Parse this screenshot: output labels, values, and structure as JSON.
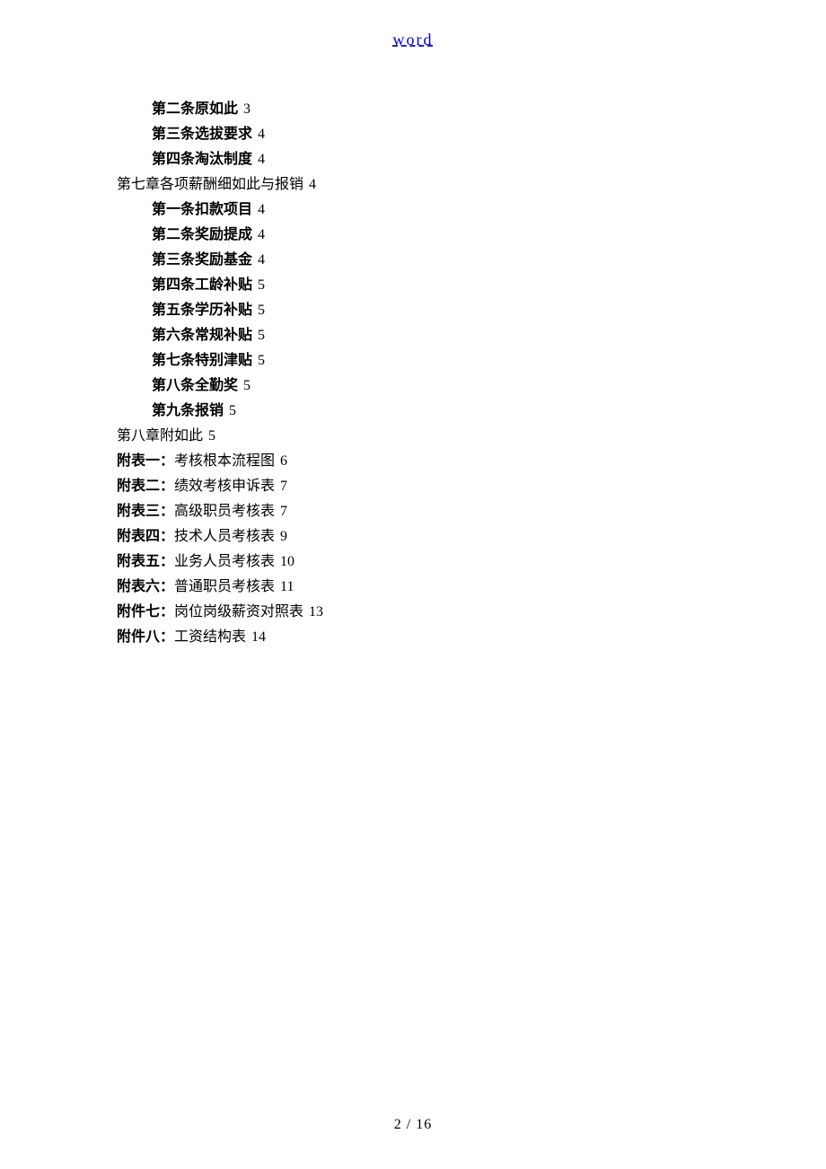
{
  "header": "word",
  "lines": [
    {
      "indent": true,
      "bold": true,
      "text": "第二条原如此",
      "page": "3"
    },
    {
      "indent": true,
      "bold": true,
      "text": "第三条选拔要求",
      "page": "4"
    },
    {
      "indent": true,
      "bold": true,
      "text": "第四条淘汰制度",
      "page": "4"
    },
    {
      "indent": false,
      "bold": false,
      "text": "第七章各项薪酬细如此与报销",
      "page": "4"
    },
    {
      "indent": true,
      "bold": true,
      "text": "第一条扣款项目",
      "page": "4"
    },
    {
      "indent": true,
      "bold": true,
      "text": "第二条奖励提成",
      "page": "4"
    },
    {
      "indent": true,
      "bold": true,
      "text": "第三条奖励基金",
      "page": "4"
    },
    {
      "indent": true,
      "bold": true,
      "text": "第四条工龄补贴",
      "page": "5"
    },
    {
      "indent": true,
      "bold": true,
      "text": "第五条学历补贴",
      "page": "5"
    },
    {
      "indent": true,
      "bold": true,
      "text": "第六条常规补贴",
      "page": "5"
    },
    {
      "indent": true,
      "bold": true,
      "text": "第七条特别津贴",
      "page": "5"
    },
    {
      "indent": true,
      "bold": true,
      "text": "第八条全勤奖",
      "page": "5"
    },
    {
      "indent": true,
      "bold": true,
      "text": "第九条报销",
      "page": "5"
    },
    {
      "indent": false,
      "bold": false,
      "text": "第八章附如此",
      "page": "5"
    },
    {
      "indent": false,
      "bold": false,
      "labelBold": "附表一：",
      "rest": "考核根本流程图",
      "page": "6"
    },
    {
      "indent": false,
      "bold": false,
      "labelBold": "附表二：",
      "rest": "绩效考核申诉表",
      "page": "7"
    },
    {
      "indent": false,
      "bold": false,
      "labelBold": "附表三：",
      "rest": "高级职员考核表",
      "page": "7"
    },
    {
      "indent": false,
      "bold": false,
      "labelBold": "附表四：",
      "rest": "技术人员考核表",
      "page": "9"
    },
    {
      "indent": false,
      "bold": false,
      "labelBold": "附表五：",
      "rest": "业务人员考核表",
      "page": "10"
    },
    {
      "indent": false,
      "bold": false,
      "labelBold": "附表六：",
      "rest": "普通职员考核表",
      "page": "11"
    },
    {
      "indent": false,
      "bold": false,
      "labelBold": "附件七：",
      "rest": "岗位岗级薪资对照表",
      "page": "13"
    },
    {
      "indent": false,
      "bold": false,
      "labelBold": "附件八：",
      "rest": "工资结构表",
      "page": "14"
    }
  ],
  "footer": "2 / 16"
}
